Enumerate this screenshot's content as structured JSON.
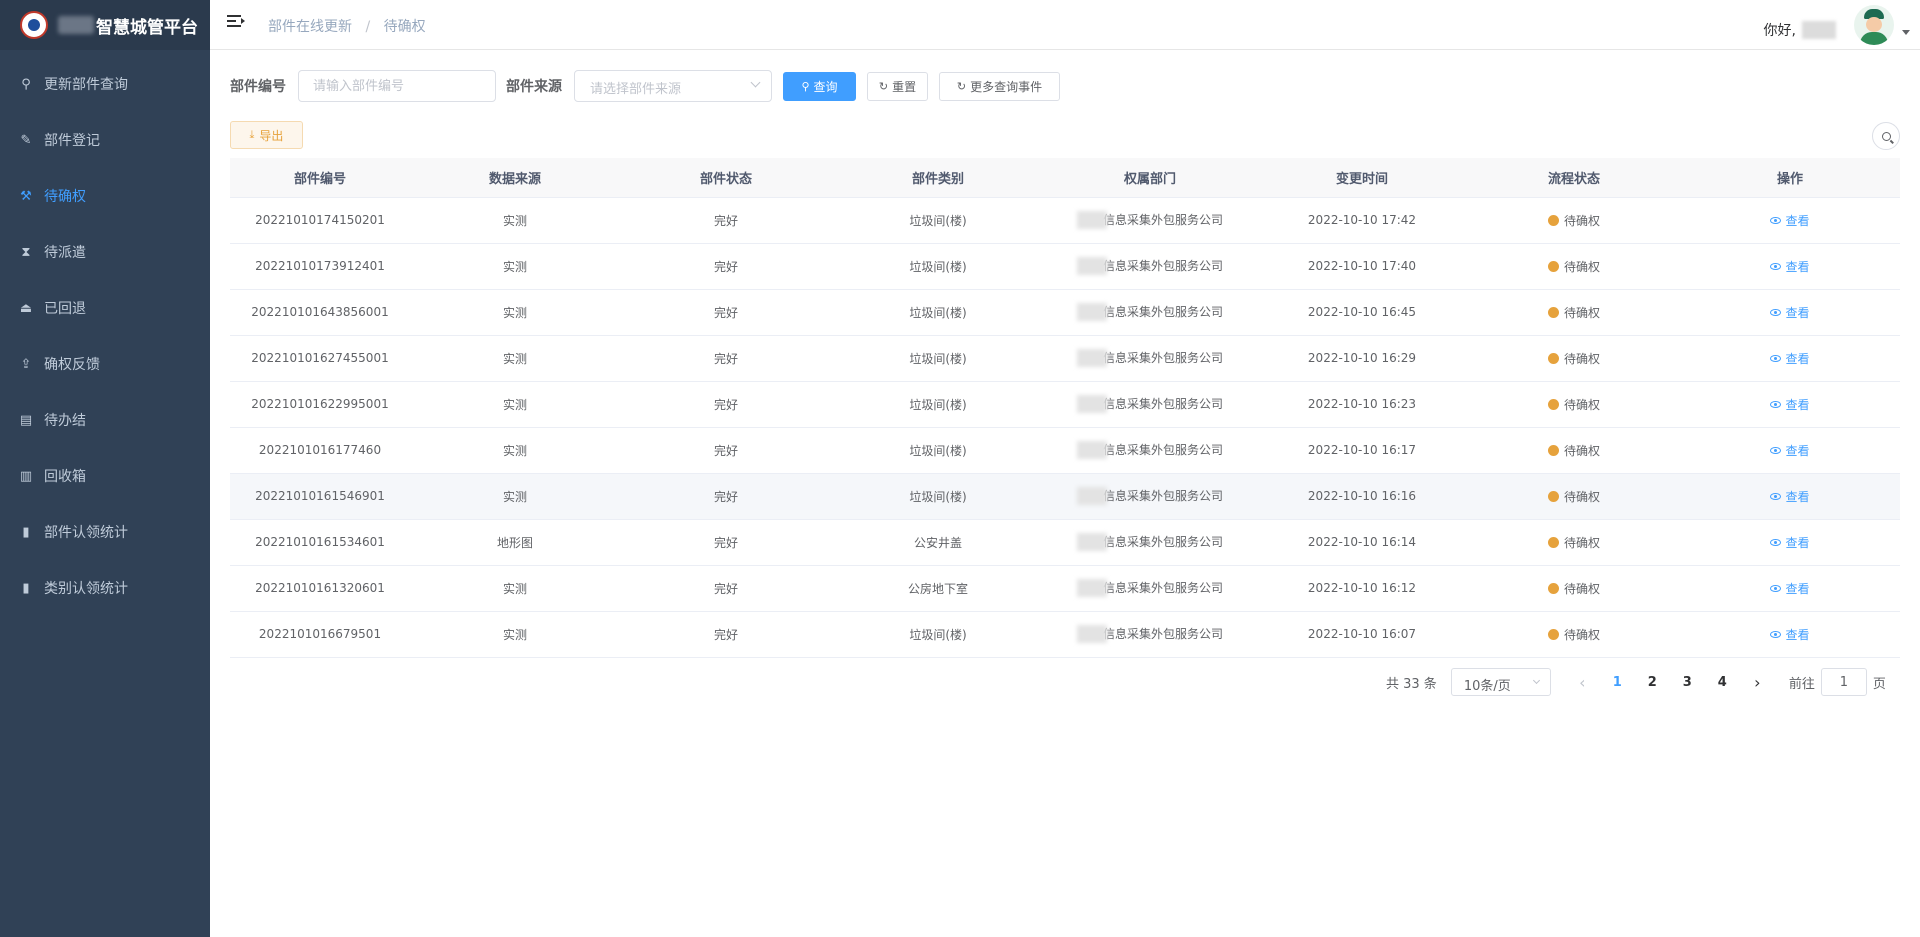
{
  "sidebar": {
    "title": "智慧城管平台",
    "items": [
      {
        "label": "更新部件查询",
        "icon": "search-icon",
        "glyph": "⚲"
      },
      {
        "label": "部件登记",
        "icon": "edit-icon",
        "glyph": "✎"
      },
      {
        "label": "待确权",
        "icon": "hammer-icon",
        "glyph": "⚒",
        "active": true
      },
      {
        "label": "待派遣",
        "icon": "hourglass-icon",
        "glyph": "⧗"
      },
      {
        "label": "已回退",
        "icon": "eject-icon",
        "glyph": "⏏"
      },
      {
        "label": "确权反馈",
        "icon": "upload-icon",
        "glyph": "⇪"
      },
      {
        "label": "待办结",
        "icon": "document-icon",
        "glyph": "▤"
      },
      {
        "label": "回收箱",
        "icon": "trash-icon",
        "glyph": "▥"
      },
      {
        "label": "部件认领统计",
        "icon": "bar-chart-icon",
        "glyph": "▮"
      },
      {
        "label": "类别认领统计",
        "icon": "bar-chart-icon",
        "glyph": "▮"
      }
    ]
  },
  "header": {
    "breadcrumb": [
      "部件在线更新",
      "待确权"
    ],
    "breadcrumb_sep": "/",
    "greeting": "你好,"
  },
  "search": {
    "code_label": "部件编号",
    "code_placeholder": "请输入部件编号",
    "source_label": "部件来源",
    "source_placeholder": "请选择部件来源",
    "query_btn": "查询",
    "reset_btn": "重置",
    "more_btn": "更多查询事件"
  },
  "toolbar": {
    "export_btn": "导出"
  },
  "table": {
    "columns": [
      "部件编号",
      "数据来源",
      "部件状态",
      "部件类别",
      "权属部门",
      "变更时间",
      "流程状态",
      "操作"
    ],
    "action_label": "查看",
    "rows": [
      {
        "code": "20221010174150201",
        "source": "实测",
        "state": "完好",
        "category": "垃圾间(楼)",
        "dept": "信息采集外包服务公司",
        "time": "2022-10-10 17:42",
        "flow": "待确权"
      },
      {
        "code": "20221010173912401",
        "source": "实测",
        "state": "完好",
        "category": "垃圾间(楼)",
        "dept": "信息采集外包服务公司",
        "time": "2022-10-10 17:40",
        "flow": "待确权"
      },
      {
        "code": "202210101643856001",
        "source": "实测",
        "state": "完好",
        "category": "垃圾间(楼)",
        "dept": "信息采集外包服务公司",
        "time": "2022-10-10 16:45",
        "flow": "待确权"
      },
      {
        "code": "202210101627455001",
        "source": "实测",
        "state": "完好",
        "category": "垃圾间(楼)",
        "dept": "信息采集外包服务公司",
        "time": "2022-10-10 16:29",
        "flow": "待确权"
      },
      {
        "code": "202210101622995001",
        "source": "实测",
        "state": "完好",
        "category": "垃圾间(楼)",
        "dept": "信息采集外包服务公司",
        "time": "2022-10-10 16:23",
        "flow": "待确权"
      },
      {
        "code": "2022101016177460",
        "source": "实测",
        "state": "完好",
        "category": "垃圾间(楼)",
        "dept": "信息采集外包服务公司",
        "time": "2022-10-10 16:17",
        "flow": "待确权"
      },
      {
        "code": "20221010161546901",
        "source": "实测",
        "state": "完好",
        "category": "垃圾间(楼)",
        "dept": "信息采集外包服务公司",
        "time": "2022-10-10 16:16",
        "flow": "待确权"
      },
      {
        "code": "20221010161534601",
        "source": "地形图",
        "state": "完好",
        "category": "公安井盖",
        "dept": "信息采集外包服务公司",
        "time": "2022-10-10 16:14",
        "flow": "待确权"
      },
      {
        "code": "20221010161320601",
        "source": "实测",
        "state": "完好",
        "category": "公房地下室",
        "dept": "信息采集外包服务公司",
        "time": "2022-10-10 16:12",
        "flow": "待确权"
      },
      {
        "code": "2022101016679501",
        "source": "实测",
        "state": "完好",
        "category": "垃圾间(楼)",
        "dept": "信息采集外包服务公司",
        "time": "2022-10-10 16:07",
        "flow": "待确权"
      }
    ]
  },
  "pagination": {
    "total": "共 33 条",
    "page_size": "10条/页",
    "pages": [
      "1",
      "2",
      "3",
      "4"
    ],
    "current": "1",
    "goto_label": "前往",
    "goto_value": "1",
    "page_unit": "页",
    "prev": "‹",
    "next": "›"
  },
  "colors": {
    "sidebar_bg": "#304156",
    "accent": "#409eff",
    "warning": "#e6a23c"
  }
}
